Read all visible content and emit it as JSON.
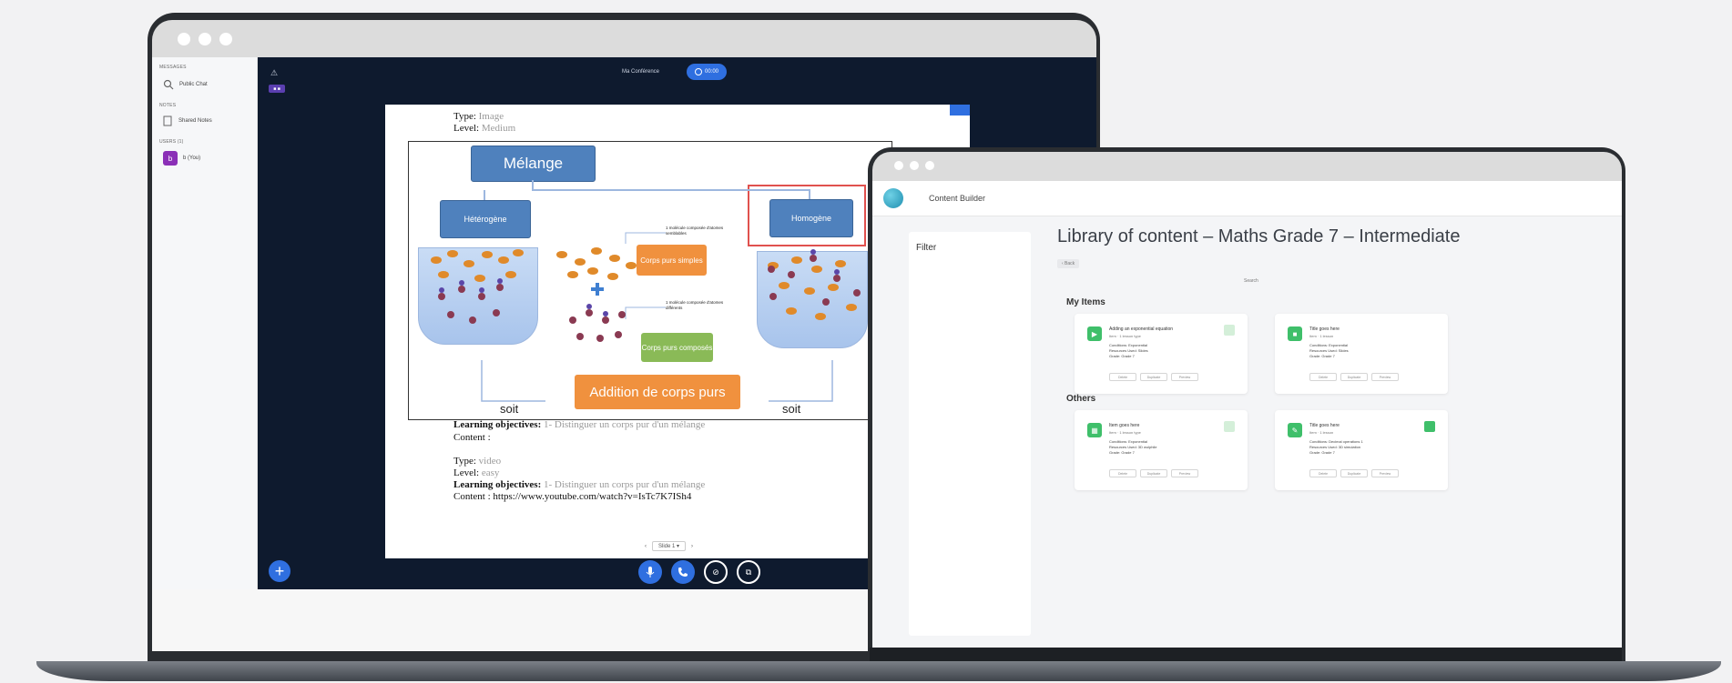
{
  "laptop1": {
    "sidebar": {
      "messages_header": "MESSAGES",
      "public_chat": "Public Chat",
      "notes_header": "NOTES",
      "shared_notes": "Shared Notes",
      "users_header": "USERS (1)",
      "user_name": "b (You)",
      "user_initial": "b"
    },
    "meeting": {
      "title": "Ma Conférence",
      "record_label": "00:00",
      "badge": "■ ■"
    },
    "document": {
      "type_label": "Type:",
      "type_value": "Image",
      "level_label": "Level:",
      "level_value": "Medium",
      "lo_label": "Learning objectives:",
      "lo_value": "1- Distinguer un corps pur d'un mélange",
      "content_label": "Content :",
      "type2_value": "video",
      "level2_value": "easy",
      "lo2_value": "1- Distinguer un corps pur d'un mélange",
      "content2": "Content : https://www.youtube.com/watch?v=IsTc7K7ISh4",
      "slide_nav": "Slide 1 ▾"
    },
    "diagram": {
      "top": "Mélange",
      "left": "Hétérogène",
      "right": "Homogène",
      "note1": "1 molécule composée d'atomes semblables",
      "note2": "1 molécule composée d'atomes différents",
      "corps_simples": "Corps purs simples",
      "corps_composes": "Corps purs composés",
      "addition": "Addition de corps purs",
      "soit_left": "soit",
      "soit_right": "soit"
    }
  },
  "laptop2": {
    "brand": "Content Builder",
    "filter_label": "Filter",
    "title": "Library of content – Maths Grade 7 – Intermediate",
    "back_button": "‹ Back",
    "search_label": "Search",
    "sections": [
      {
        "name": "My Items",
        "cards": [
          {
            "title": "Adding an exponential equation",
            "sub": "Item · 1 lesson type",
            "lines": [
              "Conditions: Exponential",
              "Resources Used: Slides",
              "Grade: Grade 7"
            ],
            "buttons": [
              "Delete",
              "Duplicate",
              "Preview"
            ]
          },
          {
            "title": "Title goes here",
            "sub": "Item · 1 lesson",
            "lines": [
              "Conditions: Exponential",
              "Resources Used: Slides",
              "Grade: Grade 7"
            ],
            "buttons": [
              "Delete",
              "Duplicate",
              "Preview"
            ]
          }
        ]
      },
      {
        "name": "Others",
        "cards": [
          {
            "title": "Item goes here",
            "sub": "Item · 1 lesson type",
            "lines": [
              "Conditions: Exponential",
              "Resources Used: 3D wolphile",
              "Grade: Grade 7"
            ],
            "buttons": [
              "Delete",
              "Duplicate",
              "Preview"
            ]
          },
          {
            "title": "Title goes here",
            "sub": "Item · 1 lesson",
            "lines": [
              "Conditions: Decimal operations 1",
              "Resources Used: 3D simulation",
              "Grade: Grade 7"
            ],
            "buttons": [
              "Delete",
              "Duplicate",
              "Preview"
            ]
          }
        ]
      }
    ]
  }
}
